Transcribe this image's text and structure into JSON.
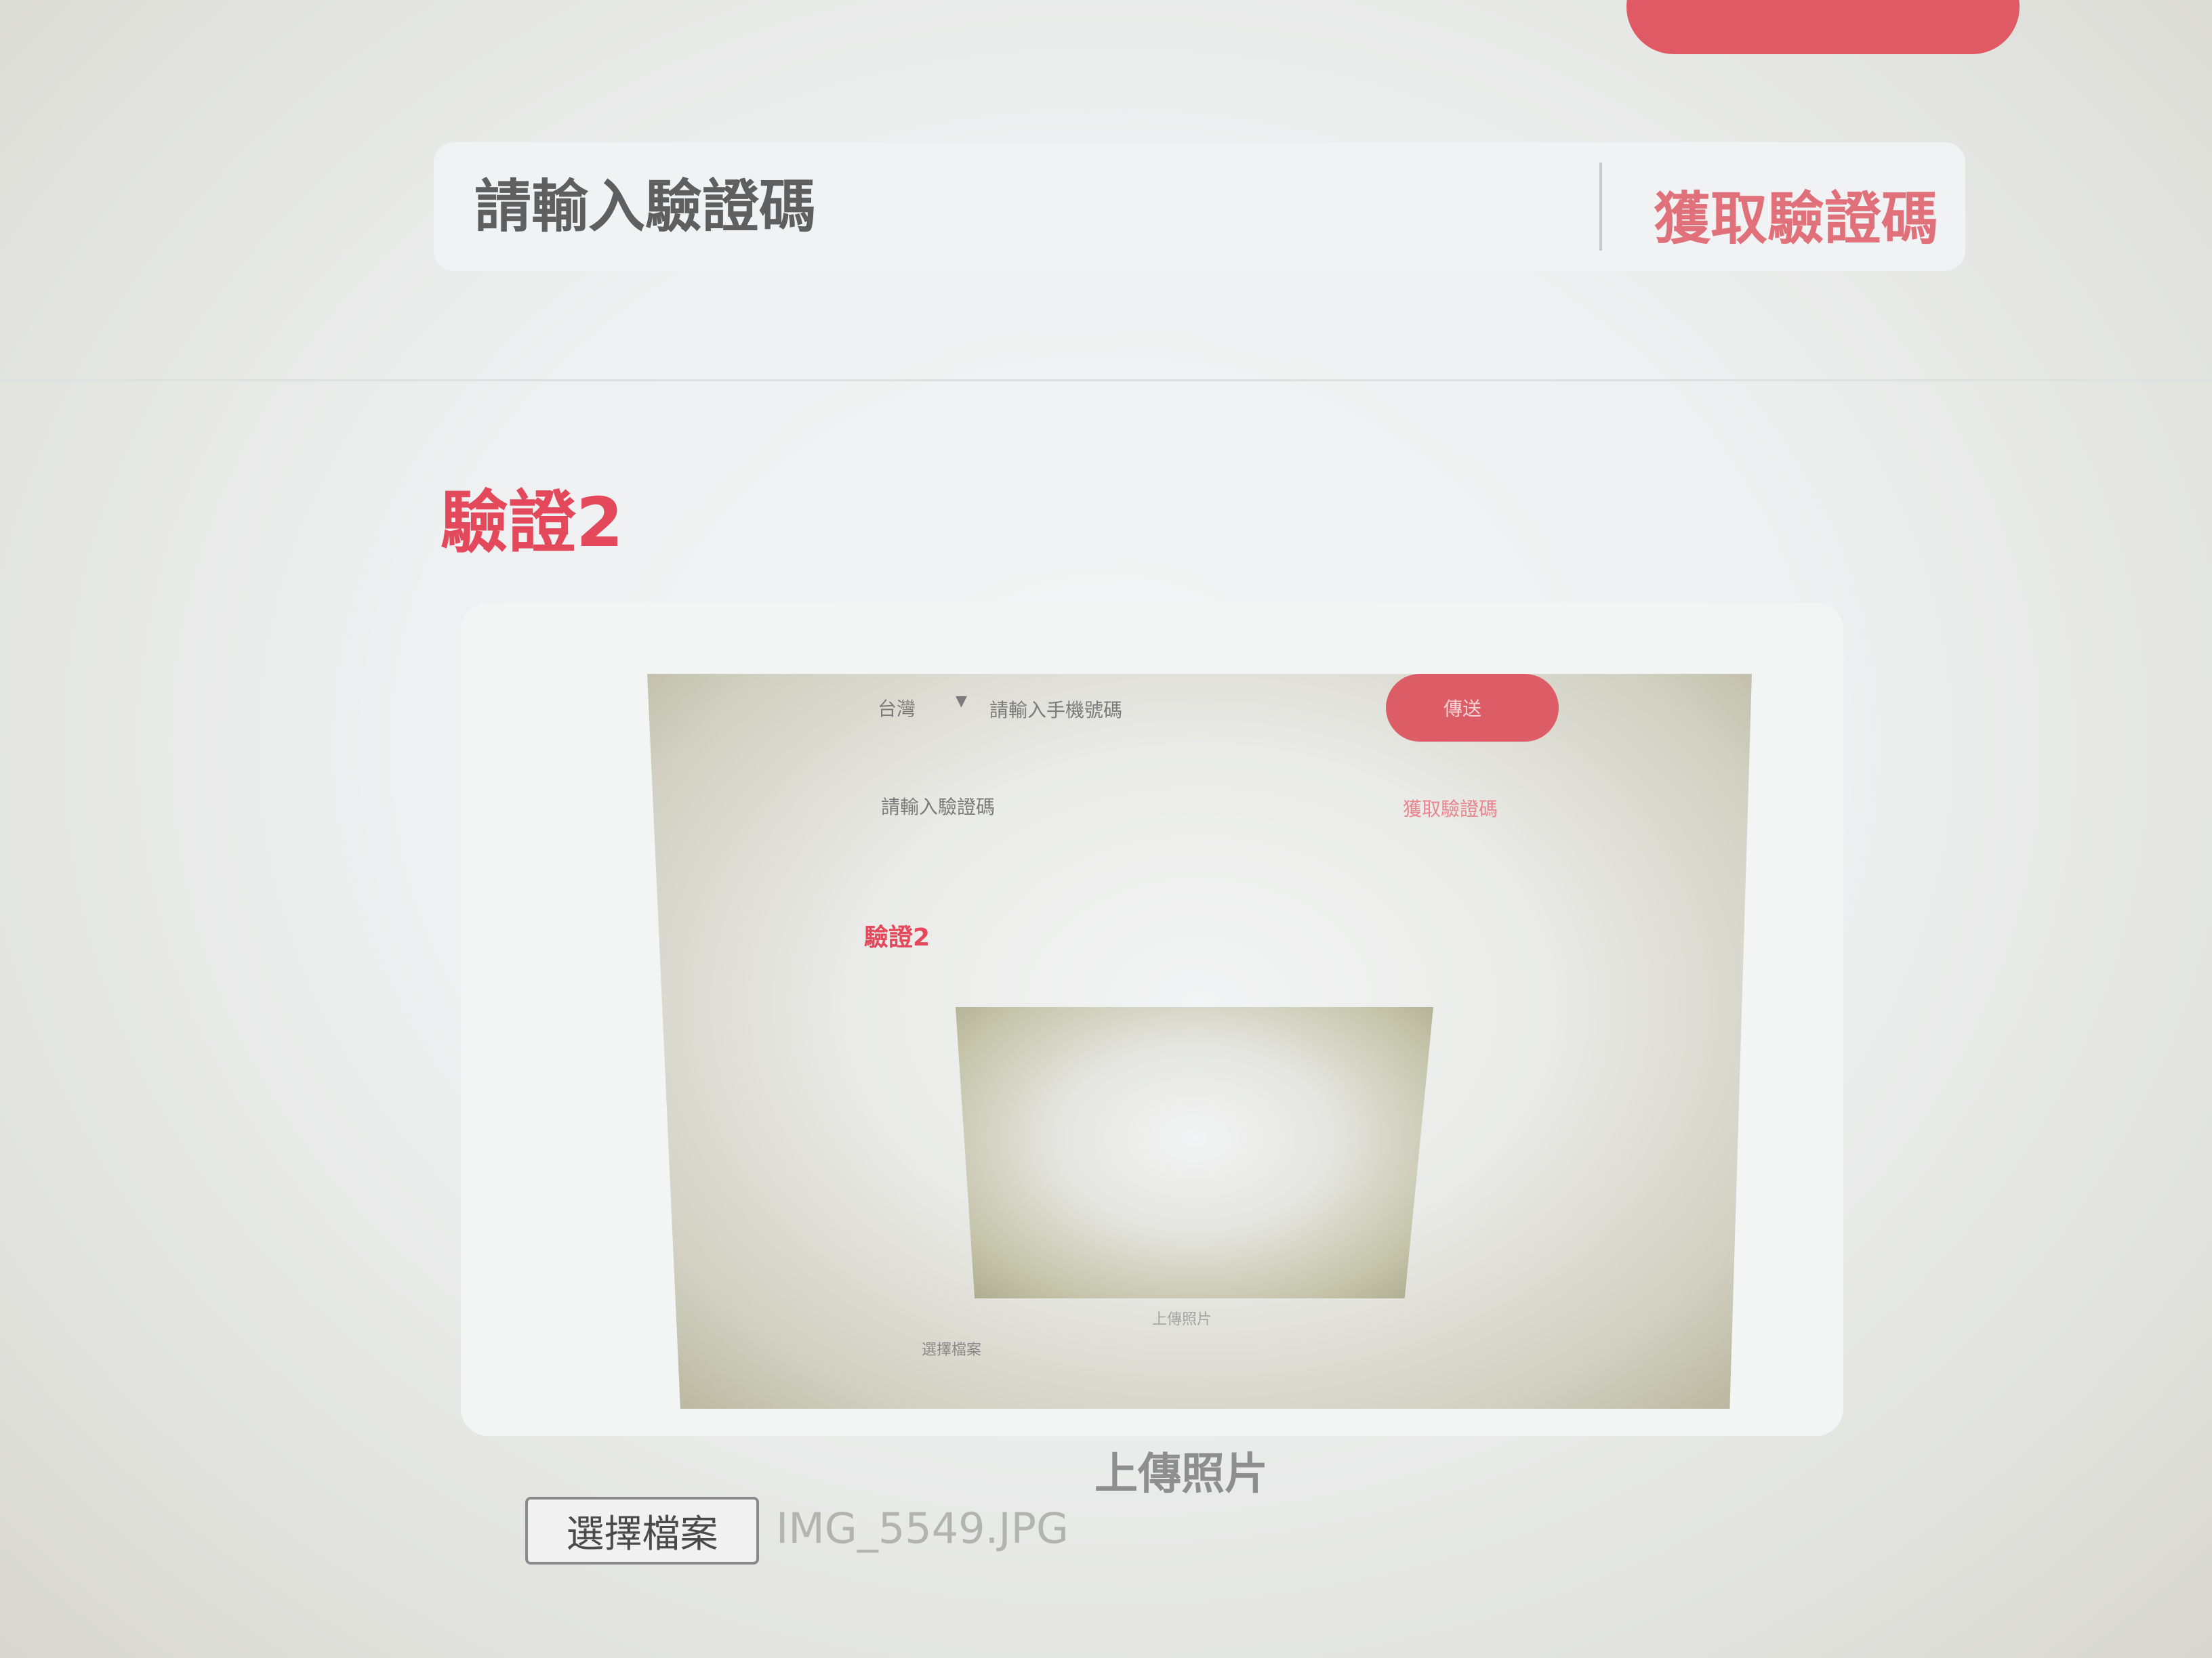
{
  "header": {
    "code_placeholder": "請輸入驗證碼",
    "get_code_label": "獲取驗證碼"
  },
  "section": {
    "title": "驗證2"
  },
  "upload": {
    "caption": "上傳照片",
    "choose_file_label": "選擇檔案",
    "file_name": "IMG_5549.JPG"
  },
  "preview": {
    "country": "台灣",
    "country_arrow": "▼",
    "phone_placeholder": "請輸入手機號碼",
    "send_label": "傳送",
    "code_placeholder": "請輸入驗證碼",
    "get_code_label": "獲取驗證碼",
    "title": "驗證2",
    "upload_caption": "上傳照片",
    "choose_file_label": "選擇檔案"
  },
  "colors": {
    "accent": "#e3485b",
    "accent_soft": "#e0717a",
    "button": "#e05a66"
  }
}
